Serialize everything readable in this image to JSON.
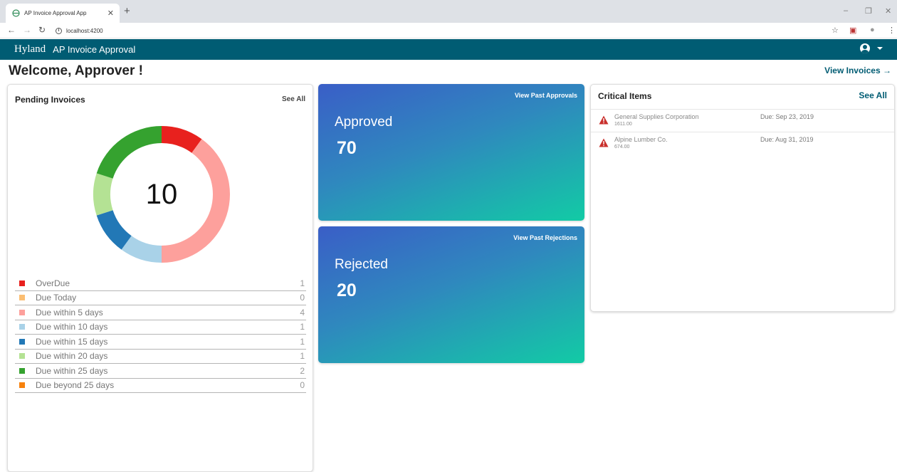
{
  "browser": {
    "tab_title": "AP Invoice Approval App",
    "url": "localhost:4200"
  },
  "header": {
    "brand": "Hyland",
    "title": "AP Invoice Approval",
    "bar_color": "#005c73"
  },
  "page": {
    "welcome": "Welcome, Approver !",
    "view_invoices": "View Invoices →"
  },
  "pending": {
    "title": "Pending Invoices",
    "see_all": "See All",
    "total": "10",
    "legend": [
      {
        "label": "OverDue",
        "count": "1",
        "color": "#e8211e"
      },
      {
        "label": "Due Today",
        "count": "0",
        "color": "#fbbe72"
      },
      {
        "label": "Due within 5 days",
        "count": "4",
        "color": "#fda09c"
      },
      {
        "label": "Due within 10 days",
        "count": "1",
        "color": "#a9d2e8"
      },
      {
        "label": "Due within 15 days",
        "count": "1",
        "color": "#2278b6"
      },
      {
        "label": "Due within 20 days",
        "count": "1",
        "color": "#b4e294"
      },
      {
        "label": "Due within 25 days",
        "count": "2",
        "color": "#35a22f"
      },
      {
        "label": "Due beyond 25 days",
        "count": "0",
        "color": "#f7820d"
      }
    ]
  },
  "chart_data": {
    "type": "pie",
    "categories": [
      "OverDue",
      "Due Today",
      "Due within 5 days",
      "Due within 10 days",
      "Due within 15 days",
      "Due within 20 days",
      "Due within 25 days",
      "Due beyond 25 days"
    ],
    "values": [
      1,
      0,
      4,
      1,
      1,
      1,
      2,
      0
    ],
    "colors": [
      "#e8211e",
      "#fbbe72",
      "#fda09c",
      "#a9d2e8",
      "#2278b6",
      "#b4e294",
      "#35a22f",
      "#f7820d"
    ],
    "center_label": "10"
  },
  "approved": {
    "link": "View Past Approvals",
    "title": "Approved",
    "count": "70"
  },
  "rejected": {
    "link": "View Past Rejections",
    "title": "Rejected",
    "count": "20"
  },
  "critical": {
    "title": "Critical Items",
    "see_all": "See All",
    "items": [
      {
        "name": "General Supplies Corporation",
        "amount": "1611.00",
        "due": "Due: Sep 23, 2019"
      },
      {
        "name": "Alpine Lumber Co.",
        "amount": "674.00",
        "due": "Due: Aug 31, 2019"
      }
    ]
  }
}
